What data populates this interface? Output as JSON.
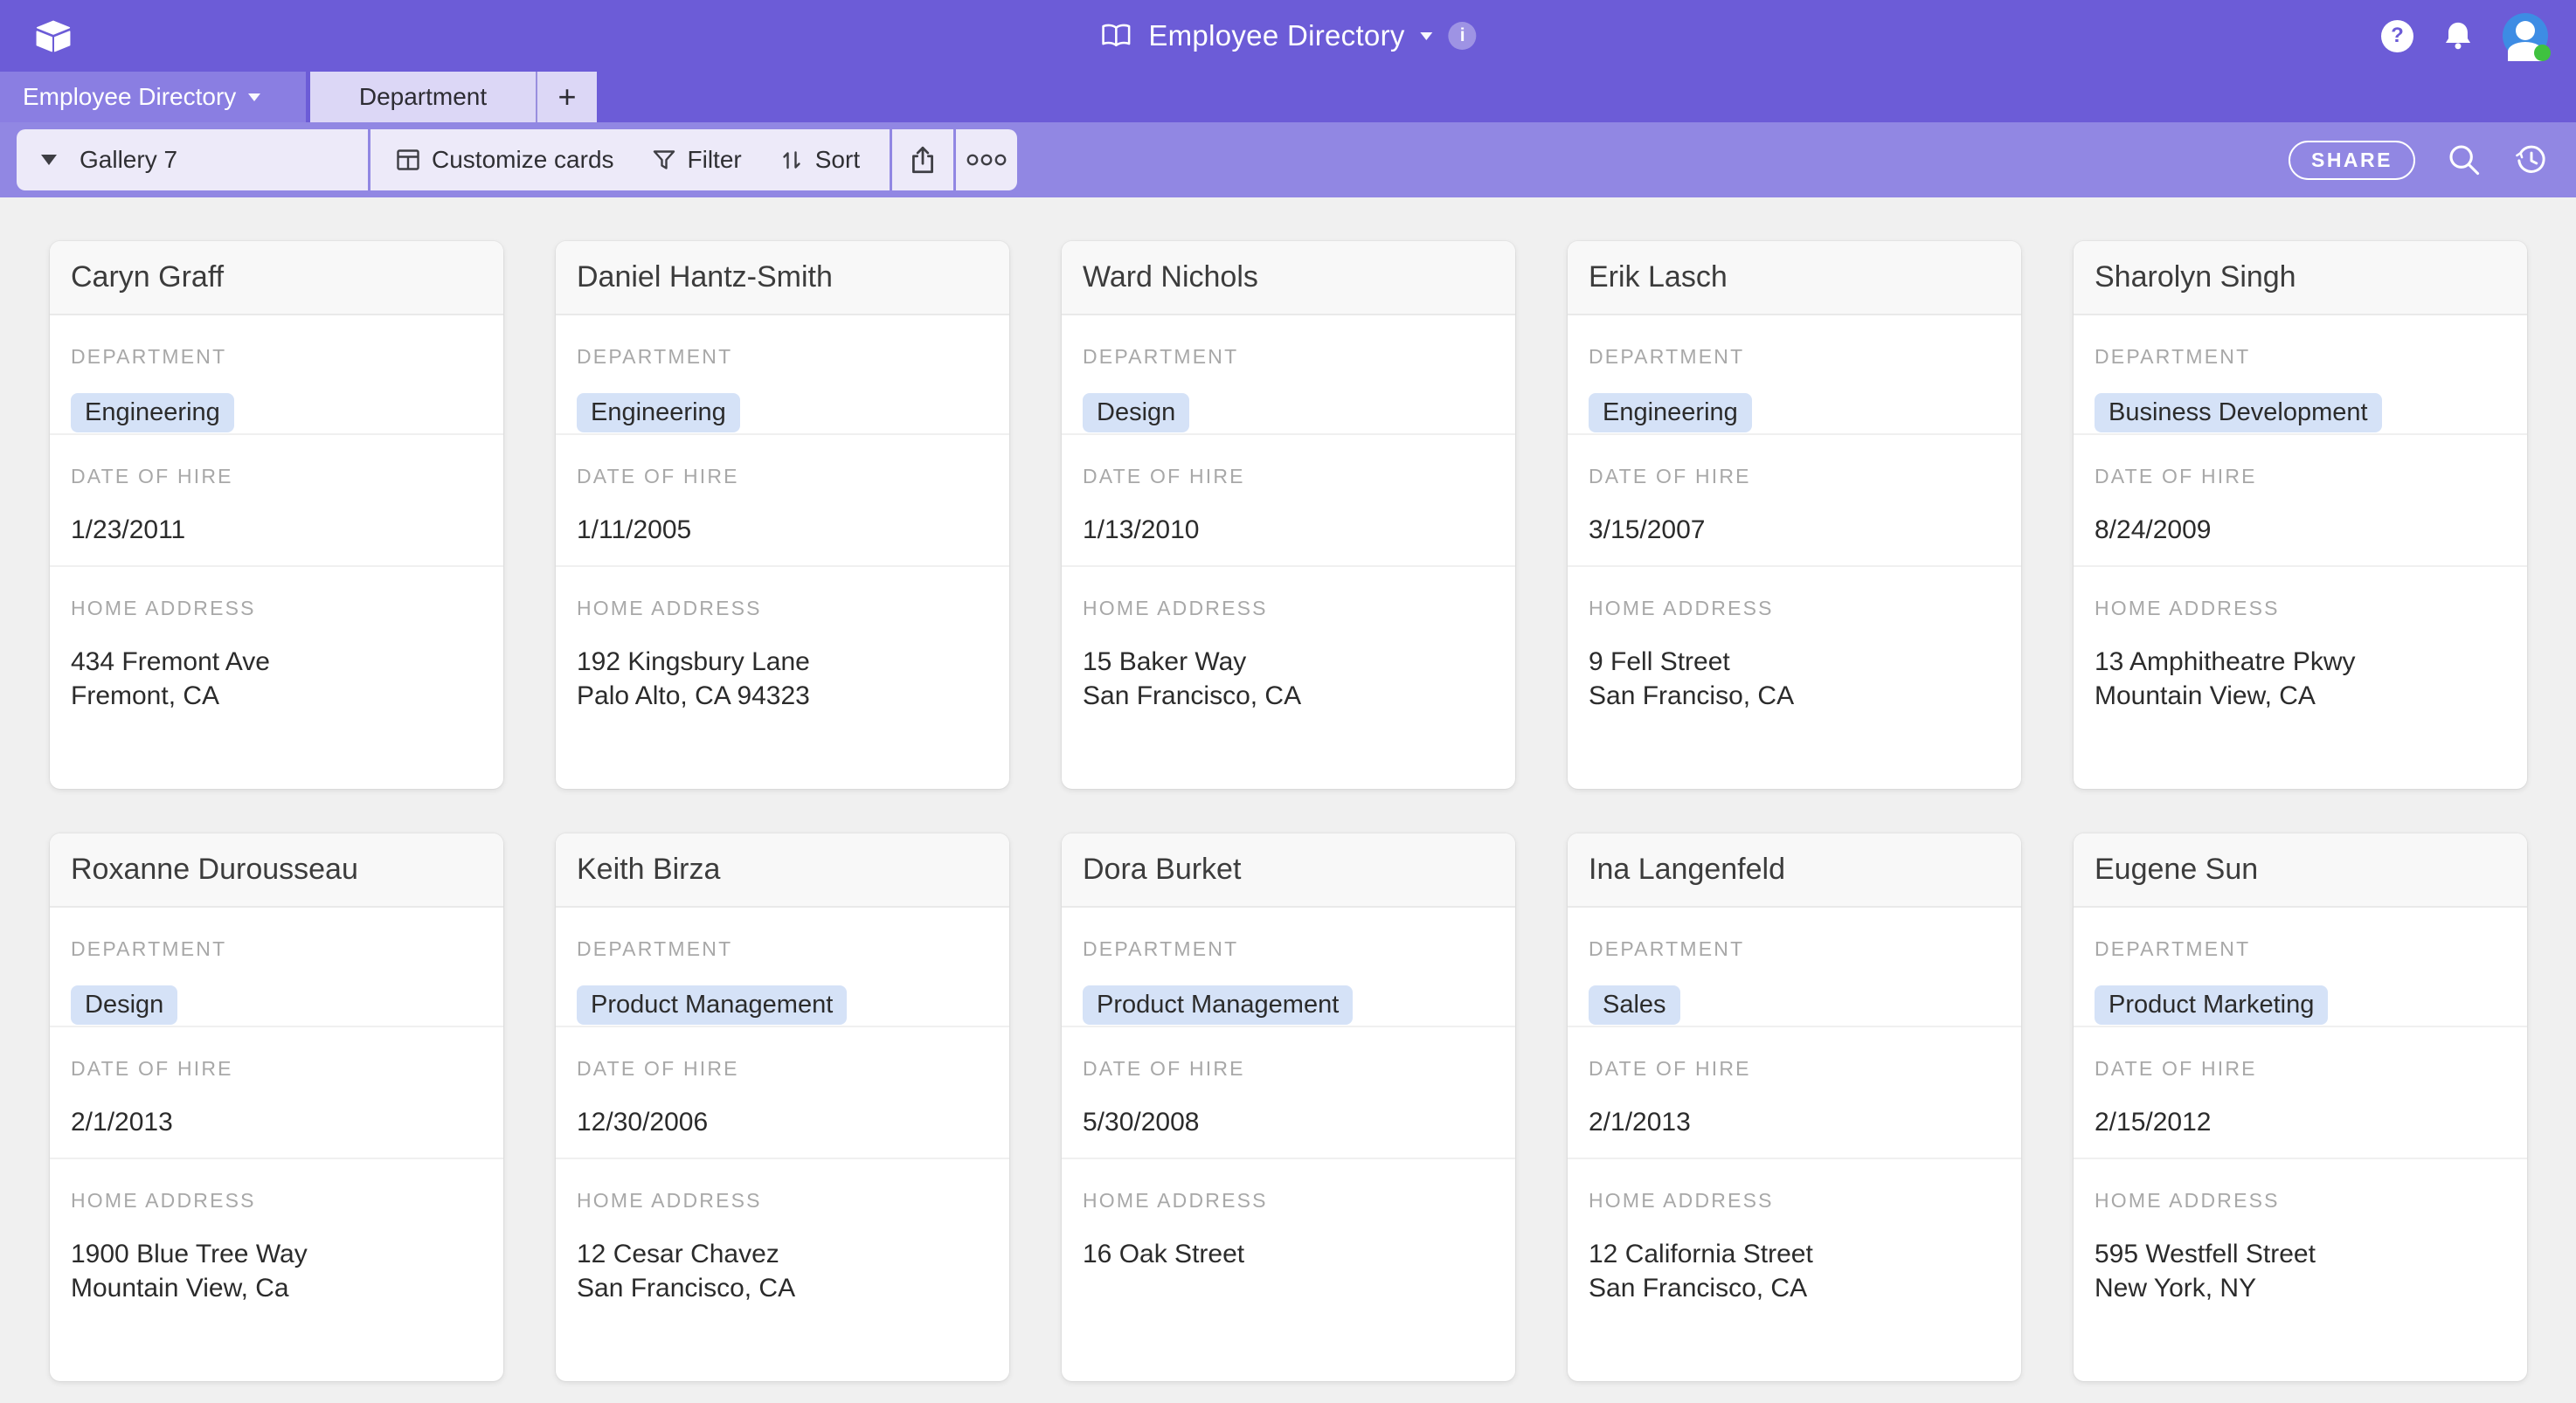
{
  "topbar": {
    "title": "Employee Directory"
  },
  "tabs": {
    "active_table": "Employee Directory",
    "second_table": "Department",
    "add_table": "+"
  },
  "toolbar": {
    "view_name": "Gallery 7",
    "customize_cards_label": "Customize cards",
    "filter_label": "Filter",
    "sort_label": "Sort",
    "share_label": "SHARE"
  },
  "field_labels": {
    "department": "DEPARTMENT",
    "date_of_hire": "DATE OF HIRE",
    "home_address": "HOME ADDRESS"
  },
  "cards": [
    {
      "name": "Caryn Graff",
      "department": "Engineering",
      "date_of_hire": "1/23/2011",
      "address_lines": [
        "434 Fremont Ave",
        "Fremont, CA"
      ]
    },
    {
      "name": "Daniel Hantz-Smith",
      "department": "Engineering",
      "date_of_hire": "1/11/2005",
      "address_lines": [
        "192 Kingsbury Lane",
        "Palo Alto, CA 94323"
      ]
    },
    {
      "name": "Ward Nichols",
      "department": "Design",
      "date_of_hire": "1/13/2010",
      "address_lines": [
        "15 Baker Way",
        "San Francisco, CA"
      ]
    },
    {
      "name": "Erik Lasch",
      "department": "Engineering",
      "date_of_hire": "3/15/2007",
      "address_lines": [
        "9 Fell Street",
        "San Franciso, CA"
      ]
    },
    {
      "name": "Sharolyn Singh",
      "department": "Business Development",
      "date_of_hire": "8/24/2009",
      "address_lines": [
        "13 Amphitheatre Pkwy",
        "Mountain View, CA"
      ]
    },
    {
      "name": "Roxanne Durousseau",
      "department": "Design",
      "date_of_hire": "2/1/2013",
      "address_lines": [
        "1900 Blue Tree Way",
        "Mountain View, Ca"
      ]
    },
    {
      "name": "Keith Birza",
      "department": "Product Management",
      "date_of_hire": "12/30/2006",
      "address_lines": [
        "12 Cesar Chavez",
        "San Francisco, CA"
      ]
    },
    {
      "name": "Dora Burket",
      "department": "Product Management",
      "date_of_hire": "5/30/2008",
      "address_lines": [
        "16 Oak Street"
      ]
    },
    {
      "name": "Ina Langenfeld",
      "department": "Sales",
      "date_of_hire": "2/1/2013",
      "address_lines": [
        "12 California Street",
        "San Francisco, CA"
      ]
    },
    {
      "name": "Eugene Sun",
      "department": "Product Marketing",
      "date_of_hire": "2/15/2012",
      "address_lines": [
        "595 Westfell Street",
        "New York, NY"
      ]
    }
  ],
  "icons": {
    "logo": "airtable-logo",
    "title_icon": "open-book",
    "info": "info-circle",
    "help": "question-circle",
    "notifications": "bell",
    "avatar_status": "online-dot",
    "view_caret": "caret-down",
    "customize": "card-grid",
    "filter": "funnel",
    "sort": "up-down-arrows",
    "export": "share-tray-arrow",
    "more": "three-dots",
    "search": "magnifier",
    "history": "clock-history"
  },
  "colors": {
    "topbar_purple": "#6C5CD7",
    "active_tab_purple": "#8A7EE2",
    "light_tab": "#DCD7F6",
    "toolbar_purple": "#9187E3",
    "toolbar_pill": "#EDEAF9",
    "content_bg": "#F0F0F0",
    "card_header_bg": "#F8F8F8",
    "department_pill_blue": "#D5E2F7",
    "avatar_blue": "#3D8CE4",
    "online_green": "#3FC13F"
  }
}
